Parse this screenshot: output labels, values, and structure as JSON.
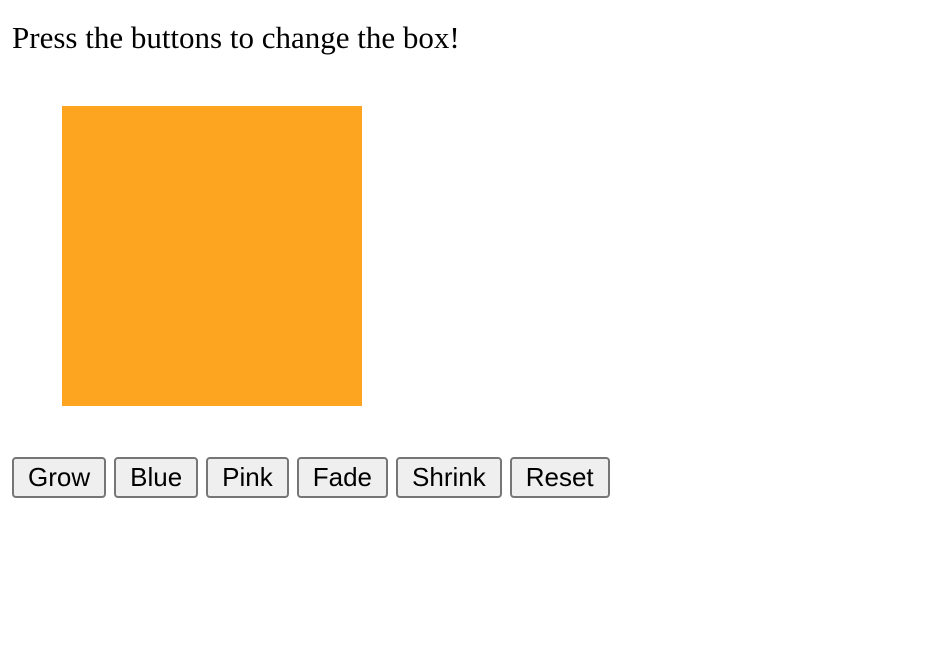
{
  "heading": "Press the buttons to change the box!",
  "box": {
    "color": "#fda521"
  },
  "buttons": {
    "grow": "Grow",
    "blue": "Blue",
    "pink": "Pink",
    "fade": "Fade",
    "shrink": "Shrink",
    "reset": "Reset"
  }
}
